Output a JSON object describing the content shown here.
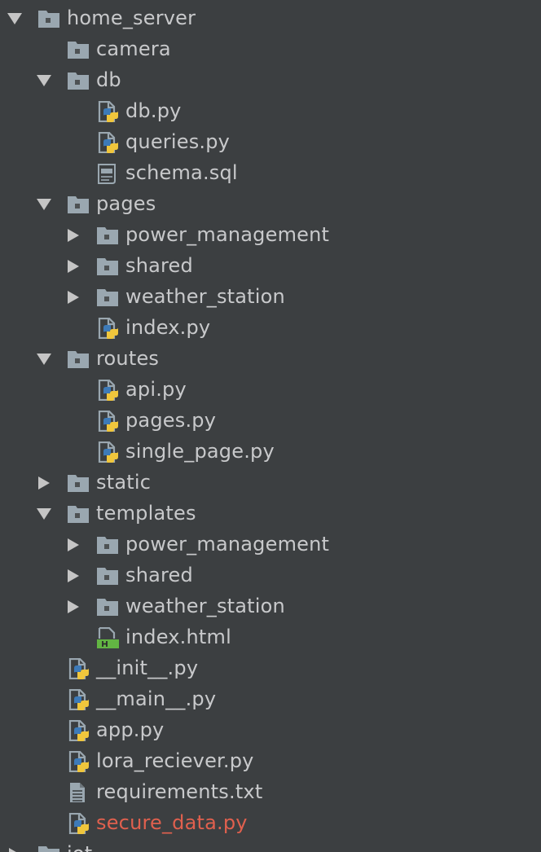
{
  "tree": {
    "rows": [
      {
        "name": "home_server",
        "kind": "folder",
        "expanded": true
      },
      {
        "name": "camera",
        "kind": "folder",
        "expanded": false,
        "leaf": true
      },
      {
        "name": "db",
        "kind": "folder",
        "expanded": true
      },
      {
        "name": "db.py",
        "kind": "python"
      },
      {
        "name": "queries.py",
        "kind": "python"
      },
      {
        "name": "schema.sql",
        "kind": "sql"
      },
      {
        "name": "pages",
        "kind": "folder",
        "expanded": true
      },
      {
        "name": "power_management",
        "kind": "folder",
        "expanded": false
      },
      {
        "name": "shared",
        "kind": "folder",
        "expanded": false
      },
      {
        "name": "weather_station",
        "kind": "folder",
        "expanded": false
      },
      {
        "name": "index.py",
        "kind": "python"
      },
      {
        "name": "routes",
        "kind": "folder",
        "expanded": true
      },
      {
        "name": "api.py",
        "kind": "python"
      },
      {
        "name": "pages.py",
        "kind": "python"
      },
      {
        "name": "single_page.py",
        "kind": "python"
      },
      {
        "name": "static",
        "kind": "folder",
        "expanded": false
      },
      {
        "name": "templates",
        "kind": "folder",
        "expanded": true
      },
      {
        "name": "power_management",
        "kind": "folder",
        "expanded": false
      },
      {
        "name": "shared",
        "kind": "folder",
        "expanded": false
      },
      {
        "name": "weather_station",
        "kind": "folder",
        "expanded": false
      },
      {
        "name": "index.html",
        "kind": "html"
      },
      {
        "name": "__init__.py",
        "kind": "python"
      },
      {
        "name": "__main__.py",
        "kind": "python"
      },
      {
        "name": "app.py",
        "kind": "python"
      },
      {
        "name": "lora_reciever.py",
        "kind": "python"
      },
      {
        "name": "requirements.txt",
        "kind": "text"
      },
      {
        "name": "secure_data.py",
        "kind": "python",
        "status": "modified"
      },
      {
        "name": "iot",
        "kind": "folder",
        "expanded": false
      }
    ]
  },
  "colors": {
    "background": "#3c3f41",
    "text": "#c8c9cb",
    "modified_text": "#e0604e",
    "folder": "#9aa7b0",
    "python_blue": "#3d7ab8",
    "python_yellow": "#f0c63c",
    "html_green": "#62b543"
  }
}
